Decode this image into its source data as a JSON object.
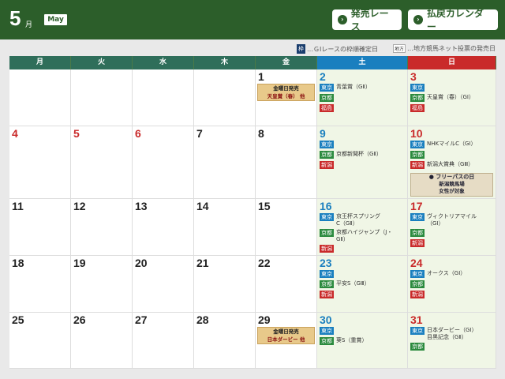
{
  "header": {
    "month": "5",
    "month_unit": "月",
    "month_en": "May",
    "btn_sale": "発売レース",
    "btn_refund": "払戻カレンダー"
  },
  "legend": {
    "waku_badge": "枠",
    "waku_text": "…ＧⅠレースの枠順確定日",
    "chiho_badge": "地方",
    "chiho_text": "…地方競馬ネット投票の発売日"
  },
  "weekdays": [
    "月",
    "火",
    "水",
    "木",
    "金",
    "土",
    "日"
  ],
  "colors": {
    "header": "#2c5e2a",
    "dow_weekday": "#2f6e5a",
    "dow_sat": "#1a7fbf",
    "dow_sun": "#c92a2a"
  },
  "days": [
    {
      "n": "1",
      "col": 4,
      "row": 0,
      "promo": [
        "金曜日発売",
        "天皇賞（春） 他"
      ]
    },
    {
      "n": "2",
      "col": 5,
      "row": 0,
      "races": [
        {
          "v": "東京",
          "k": "tokyo",
          "name": "青葉賞（GⅡ）"
        },
        {
          "v": "京都",
          "k": "kyoto",
          "name": ""
        },
        {
          "v": "福島",
          "k": "fuk",
          "name": ""
        }
      ]
    },
    {
      "n": "3",
      "col": 6,
      "row": 0,
      "races": [
        {
          "v": "東京",
          "k": "tokyo",
          "name": ""
        },
        {
          "v": "京都",
          "k": "kyoto",
          "name": "天皇賞（春）（GⅠ）"
        },
        {
          "v": "福島",
          "k": "fuk",
          "name": ""
        }
      ]
    },
    {
      "n": "4",
      "col": 0,
      "row": 1,
      "holiday": true
    },
    {
      "n": "5",
      "col": 1,
      "row": 1,
      "holiday": true
    },
    {
      "n": "6",
      "col": 2,
      "row": 1,
      "holiday": true
    },
    {
      "n": "7",
      "col": 3,
      "row": 1
    },
    {
      "n": "8",
      "col": 4,
      "row": 1
    },
    {
      "n": "9",
      "col": 5,
      "row": 1,
      "races": [
        {
          "v": "東京",
          "k": "tokyo",
          "name": ""
        },
        {
          "v": "京都",
          "k": "kyoto",
          "name": "京都新聞杯（GⅡ）"
        },
        {
          "v": "新潟",
          "k": "nii",
          "name": ""
        }
      ]
    },
    {
      "n": "10",
      "col": 6,
      "row": 1,
      "races": [
        {
          "v": "東京",
          "k": "tokyo",
          "name": "NHKマイルC（GⅠ）"
        },
        {
          "v": "京都",
          "k": "kyoto",
          "name": ""
        },
        {
          "v": "新潟",
          "k": "nii",
          "name": "新潟大賞典（GⅢ）"
        }
      ],
      "freepass": [
        "フリーパスの日",
        "新潟競馬場",
        "女性が対象"
      ]
    },
    {
      "n": "11",
      "col": 0,
      "row": 2
    },
    {
      "n": "12",
      "col": 1,
      "row": 2
    },
    {
      "n": "13",
      "col": 2,
      "row": 2
    },
    {
      "n": "14",
      "col": 3,
      "row": 2
    },
    {
      "n": "15",
      "col": 4,
      "row": 2
    },
    {
      "n": "16",
      "col": 5,
      "row": 2,
      "races": [
        {
          "v": "東京",
          "k": "tokyo",
          "name": "京王杯スプリング",
          "name2": "C（GⅡ）"
        },
        {
          "v": "京都",
          "k": "kyoto",
          "name": "京都ハイジャンプ（J・",
          "name2": "GⅡ）"
        },
        {
          "v": "新潟",
          "k": "nii",
          "name": ""
        }
      ]
    },
    {
      "n": "17",
      "col": 6,
      "row": 2,
      "races": [
        {
          "v": "東京",
          "k": "tokyo",
          "name": "ヴィクトリアマイル",
          "name2": "（GⅠ）"
        },
        {
          "v": "京都",
          "k": "kyoto",
          "name": ""
        },
        {
          "v": "新潟",
          "k": "nii",
          "name": ""
        }
      ]
    },
    {
      "n": "18",
      "col": 0,
      "row": 3
    },
    {
      "n": "19",
      "col": 1,
      "row": 3
    },
    {
      "n": "20",
      "col": 2,
      "row": 3
    },
    {
      "n": "21",
      "col": 3,
      "row": 3
    },
    {
      "n": "22",
      "col": 4,
      "row": 3
    },
    {
      "n": "23",
      "col": 5,
      "row": 3,
      "races": [
        {
          "v": "東京",
          "k": "tokyo",
          "name": ""
        },
        {
          "v": "京都",
          "k": "kyoto",
          "name": "平安S（GⅢ）"
        },
        {
          "v": "新潟",
          "k": "nii",
          "name": ""
        }
      ]
    },
    {
      "n": "24",
      "col": 6,
      "row": 3,
      "races": [
        {
          "v": "東京",
          "k": "tokyo",
          "name": "オークス（GⅠ）"
        },
        {
          "v": "京都",
          "k": "kyoto",
          "name": ""
        },
        {
          "v": "新潟",
          "k": "nii",
          "name": ""
        }
      ]
    },
    {
      "n": "25",
      "col": 0,
      "row": 4
    },
    {
      "n": "26",
      "col": 1,
      "row": 4
    },
    {
      "n": "27",
      "col": 2,
      "row": 4
    },
    {
      "n": "28",
      "col": 3,
      "row": 4
    },
    {
      "n": "29",
      "col": 4,
      "row": 4,
      "promo": [
        "金曜日発売",
        "日本ダービー 他"
      ]
    },
    {
      "n": "30",
      "col": 5,
      "row": 4,
      "races": [
        {
          "v": "東京",
          "k": "tokyo",
          "name": ""
        },
        {
          "v": "京都",
          "k": "kyoto",
          "name": "葵S（重賞）"
        }
      ]
    },
    {
      "n": "31",
      "col": 6,
      "row": 4,
      "races": [
        {
          "v": "東京",
          "k": "tokyo",
          "name": "日本ダービー（GⅠ）",
          "name2": "目黒記念（GⅡ）"
        },
        {
          "v": "京都",
          "k": "kyoto",
          "name": ""
        }
      ]
    }
  ]
}
